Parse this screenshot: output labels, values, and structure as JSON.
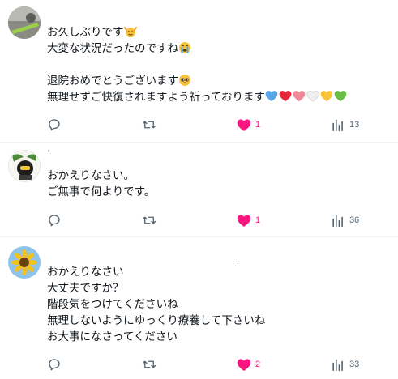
{
  "replies": [
    {
      "lines": [
        "お久しぶりです",
        "大変な状況だったのですね",
        "",
        "退院おめでとうございます",
        "無理せずご快復されますよう祈っております"
      ],
      "handle_mark": "",
      "stats": {
        "replies": "",
        "retweets": "",
        "likes": "1",
        "views": "13"
      },
      "liked": true,
      "emojis": [
        "raising-hands-face",
        "loudly-crying-face",
        "pleading-face"
      ],
      "hearts": [
        "#5aa7e8",
        "#e0283a",
        "#f08a99",
        "#eeeeee",
        "#f7c43c",
        "#6cbd45"
      ]
    },
    {
      "lines": [
        "おかえりなさい。",
        "ご無事で何よりです。"
      ],
      "handle_mark": "·",
      "stats": {
        "replies": "",
        "retweets": "",
        "likes": "1",
        "views": "36"
      },
      "liked": true
    },
    {
      "lines": [
        "おかえりなさい",
        "大丈夫ですか？",
        "階段気をつけてくださいね",
        "無理しないようにゆっくり療養して下さいね",
        "お大事になさってください"
      ],
      "handle_mark": "·",
      "stats": {
        "replies": "",
        "retweets": "",
        "likes": "2",
        "views": "33"
      },
      "liked": true
    }
  ],
  "colors": {
    "like_active": "#f91880",
    "icon_gray": "#536471",
    "divider": "#eff3f4"
  },
  "icons": [
    "reply-icon",
    "retweet-icon",
    "like-icon",
    "views-icon"
  ]
}
